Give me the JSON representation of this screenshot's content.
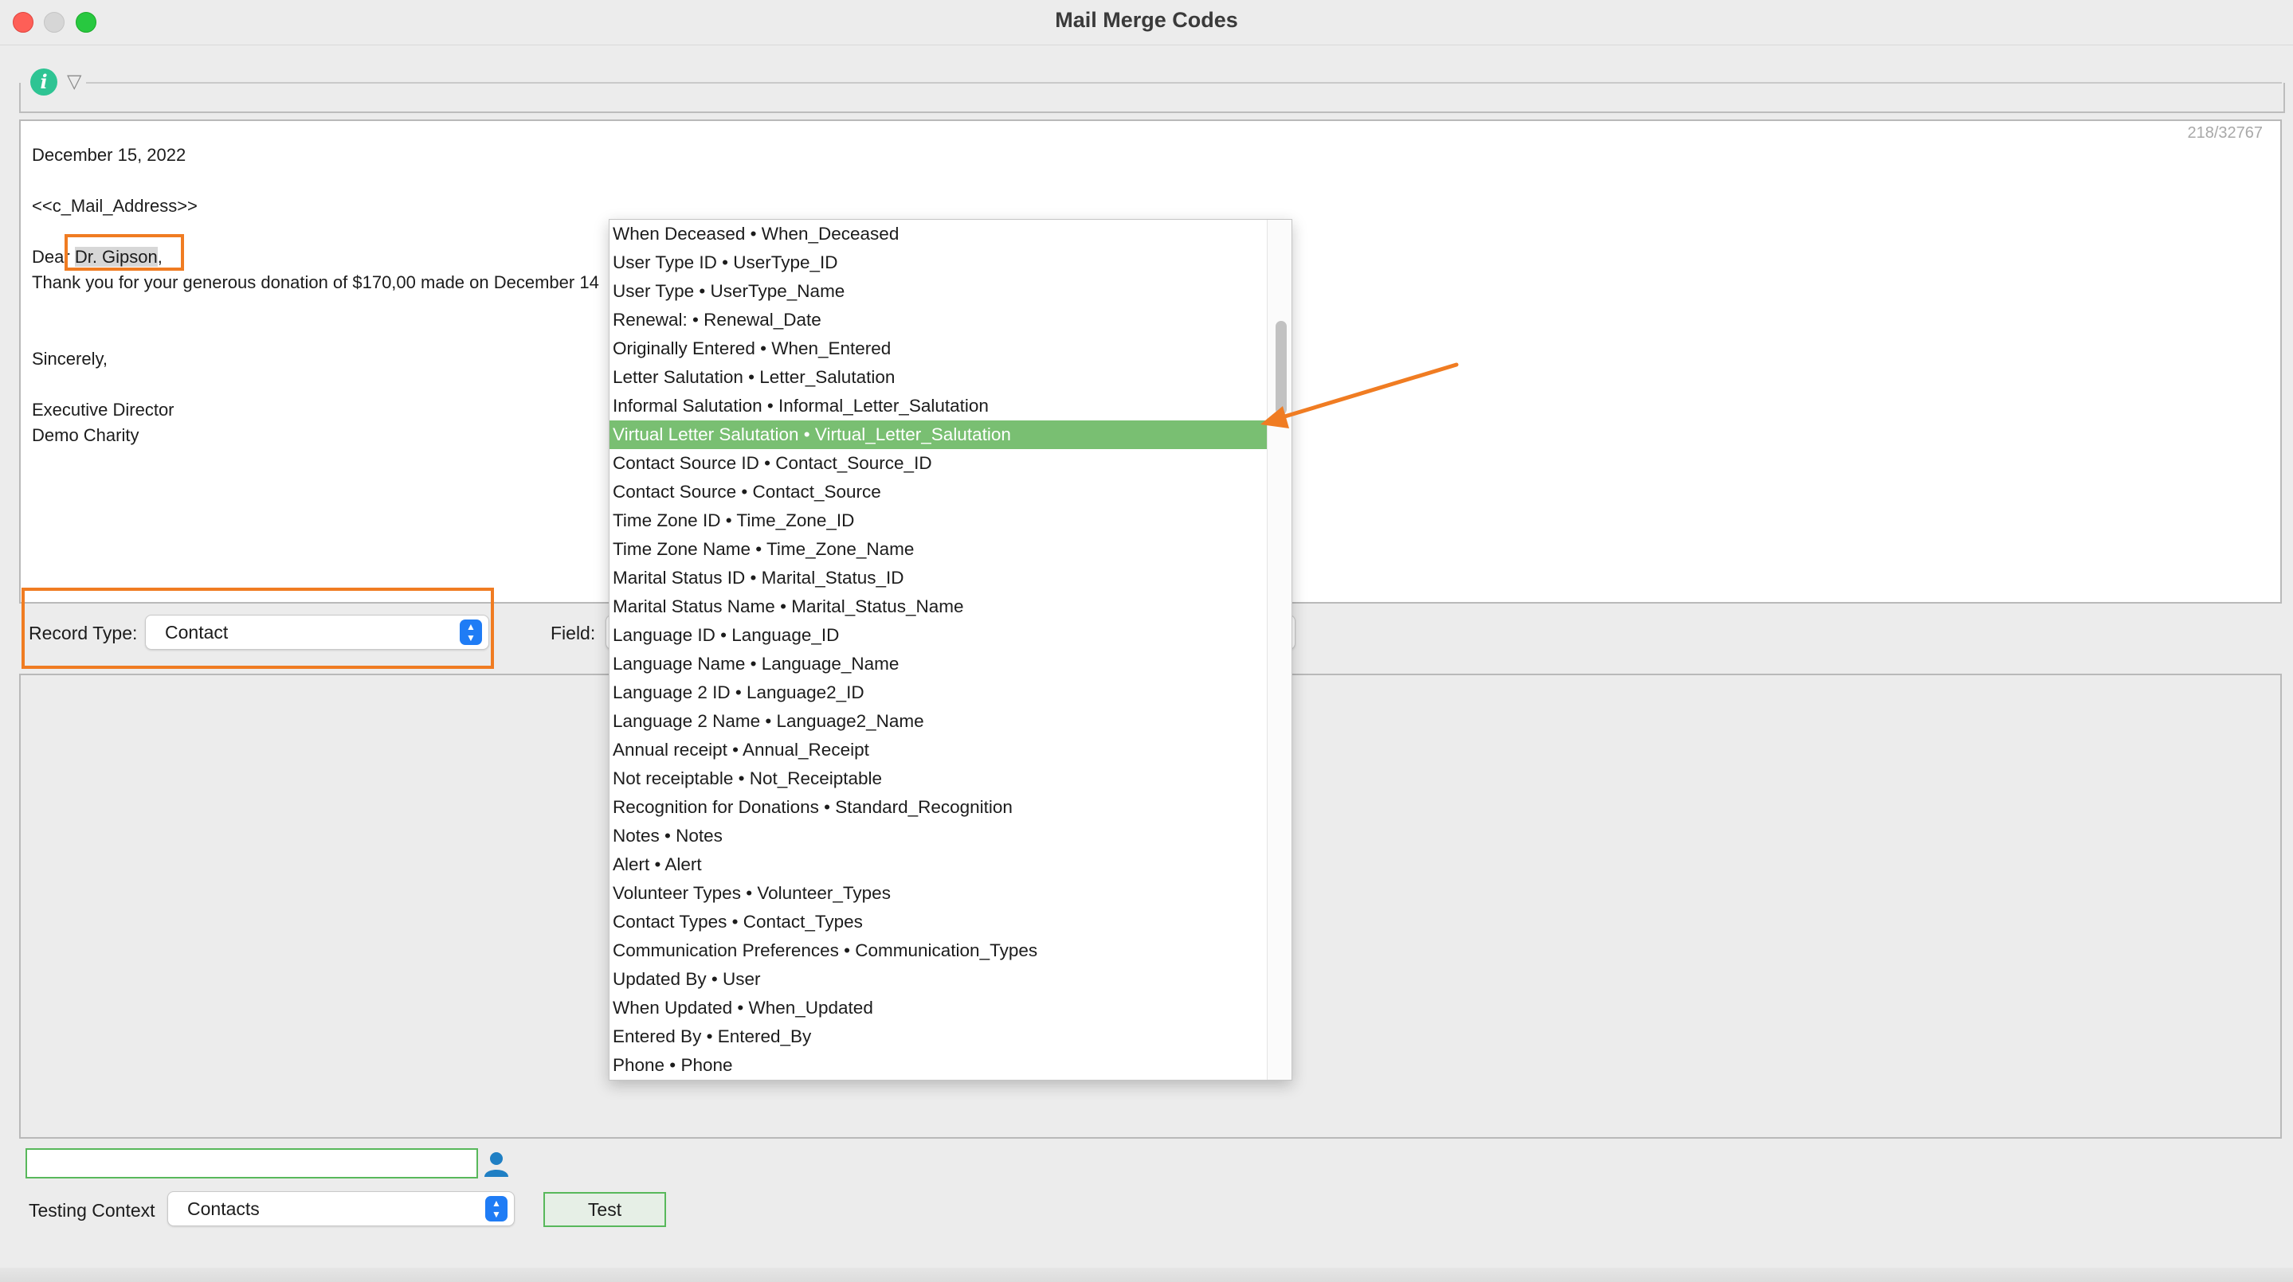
{
  "window": {
    "title": "Mail Merge Codes"
  },
  "editor": {
    "counter": "218/32767",
    "date_line": "December 15, 2022",
    "address_code": "<<c_Mail_Address>>",
    "dear_prefix": "Dear",
    "salutation_name": "Dr. Gipson",
    "salutation_suffix": ",",
    "thanks_line": "Thank you for your generous donation of $170,00 made on December 14",
    "closing": "Sincerely,",
    "signer_title": "Executive Director",
    "signer_org": "Demo Charity"
  },
  "record_type": {
    "label": "Record Type:",
    "value": "Contact"
  },
  "field": {
    "label": "Field:"
  },
  "field_dropdown": {
    "items": [
      "When Deceased • When_Deceased",
      "User Type ID • UserType_ID",
      "User Type • UserType_Name",
      "Renewal: • Renewal_Date",
      "Originally Entered  • When_Entered",
      "Letter Salutation • Letter_Salutation",
      "Informal Salutation • Informal_Letter_Salutation",
      "Virtual Letter Salutation • Virtual_Letter_Salutation",
      "Contact Source ID • Contact_Source_ID",
      "Contact Source • Contact_Source",
      "Time Zone ID • Time_Zone_ID",
      "Time Zone Name • Time_Zone_Name",
      "Marital Status ID • Marital_Status_ID",
      "Marital Status Name • Marital_Status_Name",
      "Language ID • Language_ID",
      "Language Name • Language_Name",
      "Language 2 ID • Language2_ID",
      "Language 2 Name • Language2_Name",
      "Annual receipt • Annual_Receipt",
      "Not receiptable • Not_Receiptable",
      "Recognition for Donations • Standard_Recognition",
      "Notes • Notes",
      "Alert • Alert",
      "Volunteer Types • Volunteer_Types",
      "Contact Types • Contact_Types",
      "Communication Preferences • Communication_Types",
      "Updated By • User",
      "When Updated • When_Updated",
      "Entered By • Entered_By",
      "Phone • Phone"
    ],
    "selected_index": 7
  },
  "testing": {
    "contact_input_value": "",
    "context_label": "Testing Context",
    "context_value": "Contacts",
    "test_button_label": "Test"
  },
  "icons": {
    "info": "info-icon",
    "toolbar_menu": "triangle-down-icon",
    "contact_lookup": "person-icon",
    "select_arrows": "up-down-chevron-icon"
  },
  "colors": {
    "annotation_orange": "#f07c22",
    "selected_row_green": "#79bf72",
    "accent_blue": "#1f7cf5",
    "focus_green": "#58b85b",
    "info_green": "#2ec493"
  }
}
